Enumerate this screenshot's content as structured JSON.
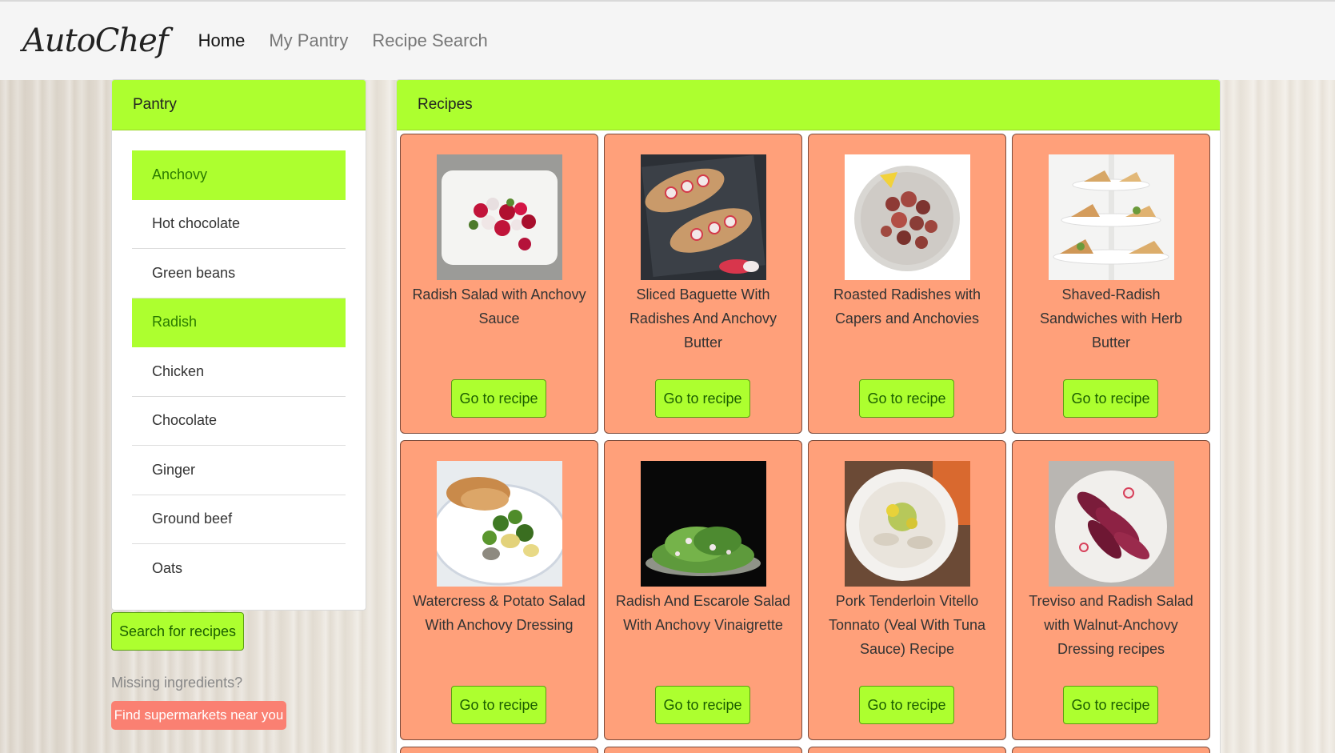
{
  "brand": "AutoChef",
  "nav": {
    "home": "Home",
    "pantry": "My Pantry",
    "search": "Recipe Search"
  },
  "pantry": {
    "title": "Pantry",
    "items": [
      {
        "label": "Anchovy",
        "selected": true
      },
      {
        "label": "Hot chocolate",
        "selected": false
      },
      {
        "label": "Green beans",
        "selected": false
      },
      {
        "label": "Radish",
        "selected": true
      },
      {
        "label": "Chicken",
        "selected": false
      },
      {
        "label": "Chocolate",
        "selected": false
      },
      {
        "label": "Ginger",
        "selected": false
      },
      {
        "label": "Ground beef",
        "selected": false
      },
      {
        "label": "Oats",
        "selected": false
      }
    ],
    "search_button": "Search for recipes",
    "missing_text": "Missing ingredients?",
    "find_button": "Find supermarkets near you"
  },
  "recipes": {
    "title": "Recipes",
    "go_label": "Go to recipe",
    "cards": [
      {
        "title": "Radish Salad with Anchovy Sauce",
        "image": "radish-salad-photo"
      },
      {
        "title": "Sliced Baguette With Radishes And Anchovy Butter",
        "image": "baguette-photo"
      },
      {
        "title": "Roasted Radishes with Capers and Anchovies",
        "image": "roasted-radishes-photo"
      },
      {
        "title": "Shaved-Radish Sandwiches with Herb Butter",
        "image": "sandwiches-photo"
      },
      {
        "title": "Watercress & Potato Salad With Anchovy Dressing",
        "image": "watercress-salad-photo"
      },
      {
        "title": "Radish And Escarole Salad With Anchovy Vinaigrette",
        "image": "escarole-salad-photo"
      },
      {
        "title": "Pork Tenderloin Vitello Tonnato (Veal With Tuna Sauce) Recipe",
        "image": "vitello-tonnato-photo"
      },
      {
        "title": "Treviso and Radish Salad with Walnut-Anchovy Dressing recipes",
        "image": "treviso-salad-photo"
      }
    ]
  },
  "colors": {
    "accent": "#adff2f",
    "card": "#ffa07a",
    "danger": "#fa8072"
  }
}
